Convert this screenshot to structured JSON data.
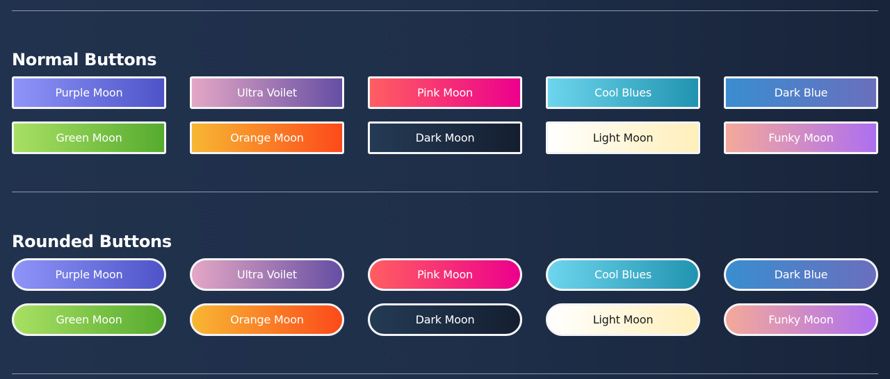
{
  "sections": [
    {
      "title": "Normal Buttons",
      "style": "normal",
      "buttons": [
        {
          "label": "Purple Moon",
          "from": "#8e94f7",
          "to": "#4e54c8"
        },
        {
          "label": "Ultra Voilet",
          "from": "#e4a7c5",
          "to": "#654ea3"
        },
        {
          "label": "Pink Moon",
          "from": "#ff5e62",
          "to": "#ec008c"
        },
        {
          "label": "Cool Blues",
          "from": "#6dd5ed",
          "to": "#2193b0"
        },
        {
          "label": "Dark Blue",
          "from": "#3a8dd0",
          "to": "#6a6fbd"
        },
        {
          "label": "Green Moon",
          "from": "#a8e063",
          "to": "#56ab2f"
        },
        {
          "label": "Orange Moon",
          "from": "#f7b733",
          "to": "#fc4a1a"
        },
        {
          "label": "Dark Moon",
          "from": "#243b55",
          "to": "#141e30"
        },
        {
          "label": "Light Moon",
          "from": "#ffffff",
          "to": "#ffefba",
          "dark_text": true
        },
        {
          "label": "Funky Moon",
          "from": "#f4a99a",
          "to": "#ad6ff0"
        }
      ]
    },
    {
      "title": "Rounded Buttons",
      "style": "rounded",
      "buttons": [
        {
          "label": "Purple Moon",
          "from": "#8e94f7",
          "to": "#4e54c8"
        },
        {
          "label": "Ultra Voilet",
          "from": "#e4a7c5",
          "to": "#654ea3"
        },
        {
          "label": "Pink Moon",
          "from": "#ff5e62",
          "to": "#ec008c"
        },
        {
          "label": "Cool Blues",
          "from": "#6dd5ed",
          "to": "#2193b0"
        },
        {
          "label": "Dark Blue",
          "from": "#3a8dd0",
          "to": "#6a6fbd"
        },
        {
          "label": "Green Moon",
          "from": "#a8e063",
          "to": "#56ab2f"
        },
        {
          "label": "Orange Moon",
          "from": "#f7b733",
          "to": "#fc4a1a"
        },
        {
          "label": "Dark Moon",
          "from": "#243b55",
          "to": "#141e30"
        },
        {
          "label": "Light Moon",
          "from": "#ffffff",
          "to": "#ffefba",
          "dark_text": true
        },
        {
          "label": "Funky Moon",
          "from": "#f4a99a",
          "to": "#ad6ff0"
        }
      ]
    }
  ]
}
